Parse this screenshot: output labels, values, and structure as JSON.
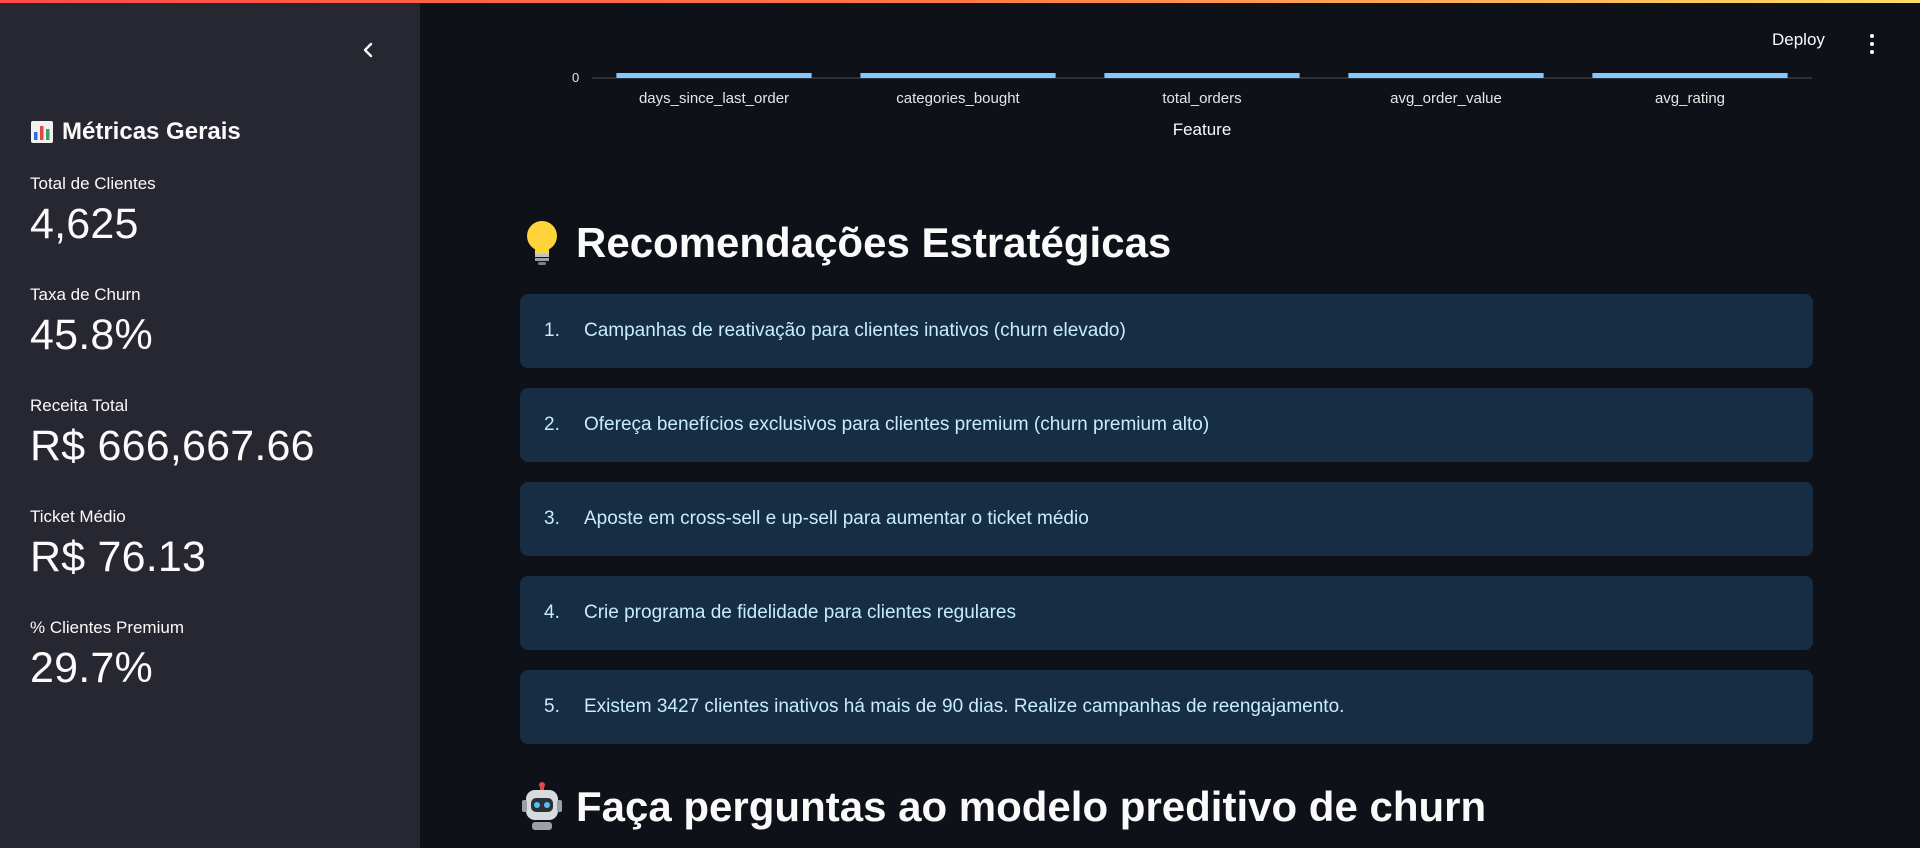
{
  "sidebar": {
    "heading": "Métricas Gerais",
    "metrics": [
      {
        "label": "Total de Clientes",
        "value": "4,625"
      },
      {
        "label": "Taxa de Churn",
        "value": "45.8%"
      },
      {
        "label": "Receita Total",
        "value": "R$ 666,667.66"
      },
      {
        "label": "Ticket Médio",
        "value": "R$ 76.13"
      },
      {
        "label": "% Clientes Premium",
        "value": "29.7%"
      }
    ]
  },
  "header": {
    "deploy_label": "Deploy"
  },
  "chart_data": {
    "type": "bar",
    "categories": [
      "days_since_last_order",
      "categories_bought",
      "total_orders",
      "avg_order_value",
      "avg_rating"
    ],
    "xlabel": "Feature",
    "y_ticks_visible": [
      "0"
    ],
    "bar_color": "#83c9ff"
  },
  "recommendations": {
    "title": "Recomendações Estratégicas",
    "items": [
      {
        "num": "1.",
        "text": "Campanhas de reativação para clientes inativos (churn elevado)"
      },
      {
        "num": "2.",
        "text": "Ofereça benefícios exclusivos para clientes premium (churn premium alto)"
      },
      {
        "num": "3.",
        "text": "Aposte em cross-sell e up-sell para aumentar o ticket médio"
      },
      {
        "num": "4.",
        "text": "Crie programa de fidelidade para clientes regulares"
      },
      {
        "num": "5.",
        "text": "Existem 3427 clientes inativos há mais de 90 dias. Realize campanhas de reengajamento."
      }
    ]
  },
  "chat_section": {
    "title": "Faça perguntas ao modelo preditivo de churn"
  },
  "icons": {
    "collapse": "chevron-left-icon",
    "metrics": "bar-chart-icon",
    "recommendations": "light-bulb-icon",
    "chat": "robot-icon",
    "menu": "kebab-menu-icon"
  }
}
